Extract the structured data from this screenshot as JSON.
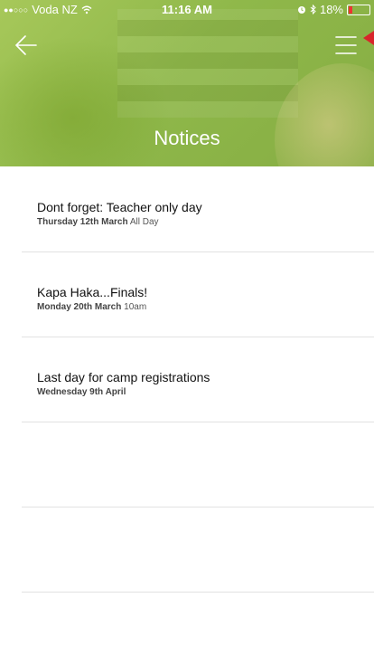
{
  "status_bar": {
    "signal_dots": "●●○○○",
    "carrier": "Voda NZ",
    "time": "11:16 AM",
    "battery_percent": "18%",
    "battery_level": 0.18,
    "icons": [
      "wifi-icon",
      "alarm-icon",
      "bluetooth-icon",
      "battery-icon"
    ]
  },
  "header": {
    "title": "Notices",
    "back_icon": "back-arrow-icon",
    "menu_icon": "hamburger-menu-icon",
    "accent_color": "#8fb84a"
  },
  "notices": [
    {
      "title": "Dont forget: Teacher only day",
      "date": "Thursday 12th March",
      "time": "All Day"
    },
    {
      "title": "Kapa Haka...Finals!",
      "date": "Monday 20th March",
      "time": "10am"
    },
    {
      "title": "Last day for camp registrations",
      "date": "Wednesday 9th April",
      "time": ""
    }
  ]
}
